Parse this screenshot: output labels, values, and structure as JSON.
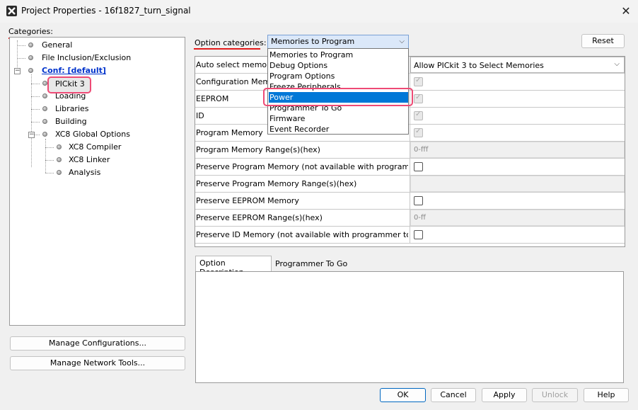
{
  "window": {
    "title": "Project Properties - 16f1827_turn_signal",
    "close_glyph": "✕",
    "icon": "app-x-icon"
  },
  "categories": {
    "label": "Categories:",
    "items": {
      "general": "General",
      "file_inclusion": "File Inclusion/Exclusion",
      "conf": "Conf: [default]",
      "pickit": "PICkit 3",
      "loading": "Loading",
      "libraries": "Libraries",
      "building": "Building",
      "xc8_global": "XC8 Global Options",
      "xc8_compiler": "XC8 Compiler",
      "xc8_linker": "XC8 Linker",
      "analysis": "Analysis"
    },
    "expand_glyph": "−"
  },
  "left_buttons": {
    "manage_configurations": "Manage Configurations...",
    "manage_network_tools": "Manage Network Tools..."
  },
  "option_categories": {
    "label": "Option categories:",
    "selected": "Memories to Program",
    "arrow": "⌵",
    "dropdown_items": [
      "Memories to Program",
      "Debug Options",
      "Program Options",
      "Freeze Peripherals",
      "Power",
      "Programmer To Go",
      "Firmware",
      "Event Recorder"
    ],
    "highlighted_item": "Power"
  },
  "reset_label": "Reset",
  "grid": {
    "rows": [
      {
        "label": "Auto select memories and ranges",
        "value": "Allow PICkit 3 to Select Memories",
        "kind": "combo"
      },
      {
        "label": "Configuration Memory",
        "kind": "check-disabled"
      },
      {
        "label": "EEPROM",
        "kind": "check-disabled"
      },
      {
        "label": "ID",
        "kind": "check-disabled"
      },
      {
        "label": "Program Memory",
        "kind": "check-disabled"
      },
      {
        "label": "Program Memory Range(s)(hex)",
        "value": "0-fff",
        "kind": "text"
      },
      {
        "label": "Preserve Program Memory (not available with programmer to go)",
        "kind": "check"
      },
      {
        "label": "Preserve Program Memory Range(s)(hex)",
        "value": "",
        "kind": "text"
      },
      {
        "label": "Preserve EEPROM Memory",
        "kind": "check"
      },
      {
        "label": "Preserve EEPROM Range(s)(hex)",
        "value": "0-ff",
        "kind": "text"
      },
      {
        "label": "Preserve ID Memory (not available with programmer to go)",
        "kind": "check"
      }
    ],
    "combo_arrow": "⌵"
  },
  "description": {
    "tab_option_description": "Option Description",
    "tab_programmer_to_go": "Programmer To Go"
  },
  "buttons": {
    "ok": "OK",
    "cancel": "Cancel",
    "apply": "Apply",
    "unlock": "Unlock",
    "help": "Help"
  },
  "colors": {
    "accent": "#0078d7",
    "highlight": "#ee4a75",
    "underline": "#e31b1b",
    "link": "#0033cc"
  }
}
